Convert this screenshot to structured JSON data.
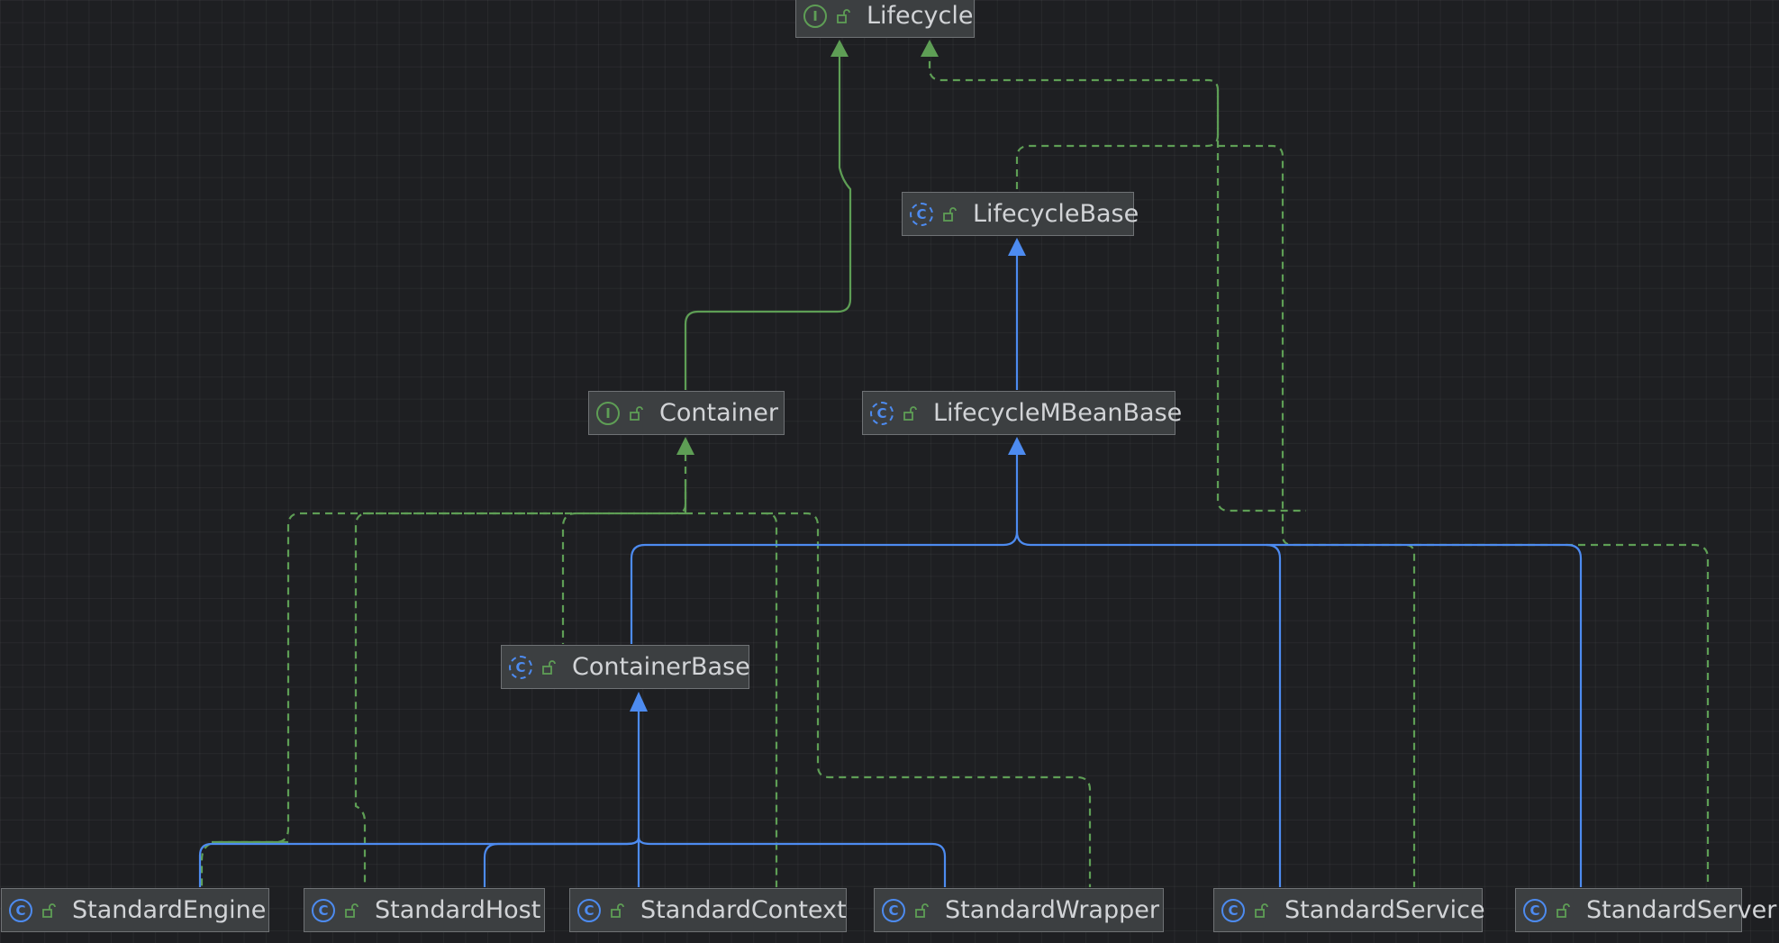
{
  "colors": {
    "extends": "#4d8bf0",
    "implements": "#5e9e55",
    "node_bg": "#3c3f41",
    "node_border": "#6f7275",
    "text": "#d2d4d7",
    "background": "#1e1f22"
  },
  "nodes": {
    "lifecycle": {
      "label": "Lifecycle",
      "kind_icon": "interface-icon",
      "kind_letter": "I"
    },
    "lifecyclebase": {
      "label": "LifecycleBase",
      "kind_icon": "abstract-class-icon",
      "kind_letter": "C"
    },
    "container": {
      "label": "Container",
      "kind_icon": "interface-icon",
      "kind_letter": "I"
    },
    "lifecyclembeanbase": {
      "label": "LifecycleMBeanBase",
      "kind_icon": "abstract-class-icon",
      "kind_letter": "C"
    },
    "containerbase": {
      "label": "ContainerBase",
      "kind_icon": "abstract-class-icon",
      "kind_letter": "C"
    },
    "standardengine": {
      "label": "StandardEngine",
      "kind_icon": "class-icon",
      "kind_letter": "C"
    },
    "standardhost": {
      "label": "StandardHost",
      "kind_icon": "class-icon",
      "kind_letter": "C"
    },
    "standardcontext": {
      "label": "StandardContext",
      "kind_icon": "class-icon",
      "kind_letter": "C"
    },
    "standardwrapper": {
      "label": "StandardWrapper",
      "kind_icon": "class-icon",
      "kind_letter": "C"
    },
    "standardservice": {
      "label": "StandardService",
      "kind_icon": "class-icon",
      "kind_letter": "C"
    },
    "standardserver": {
      "label": "StandardServer",
      "kind_icon": "class-icon",
      "kind_letter": "C"
    }
  },
  "edges": [
    {
      "from": "Container",
      "to": "Lifecycle",
      "type": "implements-solid"
    },
    {
      "from": "LifecycleBase",
      "to": "Lifecycle",
      "type": "implements-dashed"
    },
    {
      "from": "LifecycleMBeanBase",
      "to": "LifecycleBase",
      "type": "extends"
    },
    {
      "from": "ContainerBase",
      "to": "LifecycleMBeanBase",
      "type": "extends"
    },
    {
      "from": "ContainerBase",
      "to": "Container",
      "type": "implements-dashed"
    },
    {
      "from": "StandardEngine",
      "to": "ContainerBase",
      "type": "extends"
    },
    {
      "from": "StandardHost",
      "to": "ContainerBase",
      "type": "extends"
    },
    {
      "from": "StandardContext",
      "to": "ContainerBase",
      "type": "extends"
    },
    {
      "from": "StandardWrapper",
      "to": "ContainerBase",
      "type": "extends"
    },
    {
      "from": "StandardService",
      "to": "LifecycleMBeanBase",
      "type": "extends"
    },
    {
      "from": "StandardServer",
      "to": "LifecycleMBeanBase",
      "type": "extends"
    }
  ]
}
